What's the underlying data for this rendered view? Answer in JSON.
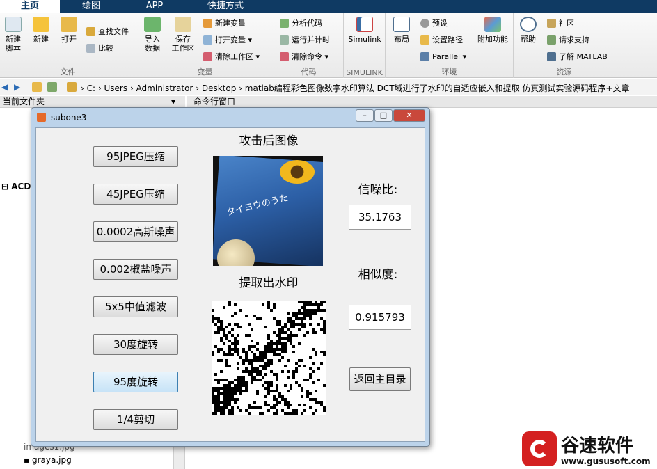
{
  "tabs": [
    {
      "label": "主页",
      "active": true
    },
    {
      "label": "绘图",
      "active": false
    },
    {
      "label": "APP",
      "active": false
    },
    {
      "label": "快捷方式",
      "active": false
    }
  ],
  "groups": {
    "file": "文件",
    "variable": "变量",
    "code": "代码",
    "simulink": "SIMULINK",
    "env": "环境",
    "resources": "资源"
  },
  "ribbon": {
    "new_script": "新建\n脚本",
    "new": "新建",
    "open": "打开",
    "find_files": "查找文件",
    "compare": "比较",
    "import": "导入\n数据",
    "save_ws": "保存\n工作区",
    "new_var": "新建变量",
    "open_var": "打开变量",
    "clear_ws": "清除工作区",
    "analyze": "分析代码",
    "run_time": "运行并计时",
    "clear_cmd": "清除命令",
    "simulink": "Simulink",
    "layout": "布局",
    "prefs": "预设",
    "set_path": "设置路径",
    "parallel": "Parallel",
    "addons": "附加功能",
    "help": "帮助",
    "community": "社区",
    "support": "请求支持",
    "learn": "了解 MATLAB"
  },
  "address": [
    "C:",
    "Users",
    "Administrator",
    "Desktop",
    "matlab编程彩色图像数字水印算法 DCT域进行了水印的自适应嵌入和提取 仿真测试实验源码程序+文章"
  ],
  "panes": {
    "current_folder": "当前文件夹",
    "command_window": "命令行窗口"
  },
  "files": [
    "ACD",
    "images1.jpg",
    "graya.jpg"
  ],
  "figure": {
    "title": "subone3",
    "attacked_title": "攻击后图像",
    "extracted_title": "提取出水印",
    "snr_label": "信噪比:",
    "snr_value": "35.1763",
    "sim_label": "相似度:",
    "sim_value": "0.915793",
    "back_button": "返回主目录",
    "buttons": [
      "95JPEG压缩",
      "45JPEG压缩",
      "0.0002高斯噪声",
      "0.002椒盐噪声",
      "5x5中值滤波",
      "30度旋转",
      "95度旋转",
      "1/4剪切"
    ],
    "image_text": "タイヨウのうた"
  },
  "watermark_logo": {
    "name": "谷速软件",
    "url": "www.gususoft.com",
    "color": "#d42020"
  }
}
